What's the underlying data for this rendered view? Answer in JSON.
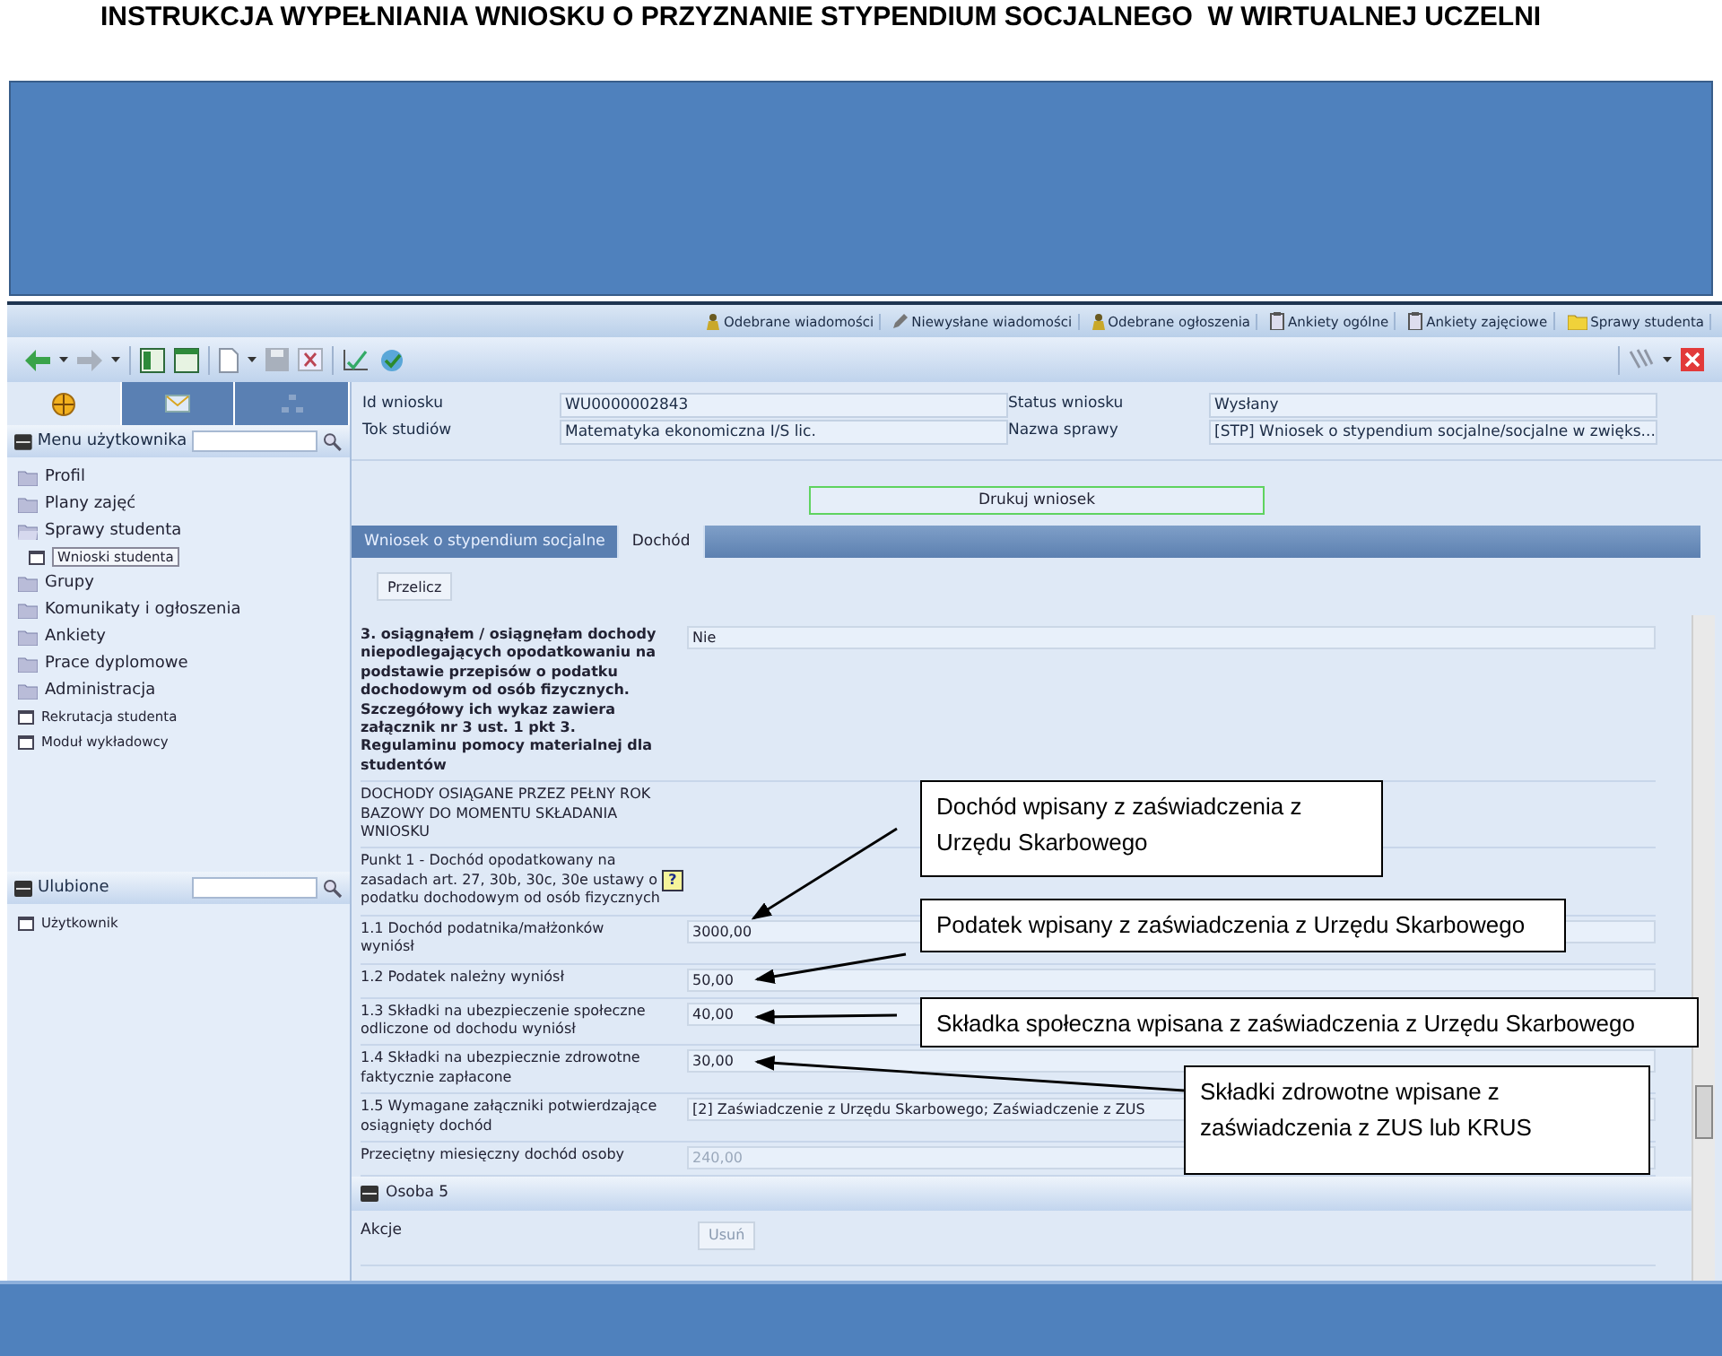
{
  "document_title": "INSTRUKCJA WYPEŁNIANIA WNIOSKU O PRZYZNANIE STYPENDIUM SOCJALNEGO  W WIRTUALNEJ UCZELNI",
  "top_links": [
    "Odebrane wiadomości",
    "Niewysłane wiadomości",
    "Odebrane ogłoszenia",
    "Ankiety ogólne",
    "Ankiety zajęciowe",
    "Sprawy studenta"
  ],
  "sidebar": {
    "tabs": [
      {
        "selected": true
      },
      {
        "selected": false
      },
      {
        "selected": false
      }
    ],
    "menu_title": "Menu użytkownika",
    "menu_items": [
      {
        "label": "Profil",
        "kind": "folder",
        "selected": false
      },
      {
        "label": "Plany zajęć",
        "kind": "folder",
        "selected": false
      },
      {
        "label": "Sprawy studenta",
        "kind": "folder",
        "selected": false,
        "children": [
          {
            "label": "Wnioski studenta",
            "kind": "page",
            "selected": true
          }
        ]
      },
      {
        "label": "Grupy",
        "kind": "folder",
        "selected": false
      },
      {
        "label": "Komunikaty i ogłoszenia",
        "kind": "folder",
        "selected": false
      },
      {
        "label": "Ankiety",
        "kind": "folder",
        "selected": false
      },
      {
        "label": "Prace dyplomowe",
        "kind": "folder",
        "selected": false
      },
      {
        "label": "Administracja",
        "kind": "folder",
        "selected": false
      },
      {
        "label": "Rekrutacja studenta",
        "kind": "page",
        "selected": false
      },
      {
        "label": "Moduł wykładowcy",
        "kind": "page",
        "selected": false
      }
    ],
    "favorites_title": "Ulubione",
    "favorites": [
      {
        "label": "Użytkownik",
        "kind": "page",
        "selected": false
      }
    ]
  },
  "header_fields": [
    {
      "label": "Id wniosku",
      "value": "WU0000002843"
    },
    {
      "label": "Status wniosku",
      "value": "Wysłany"
    },
    {
      "label": "Tok studiów",
      "value": "Matematyka ekonomiczna I/S lic."
    },
    {
      "label": "Nazwa sprawy",
      "value": "[STP] Wniosek o stypendium socjalne/socjalne w zwięks..."
    }
  ],
  "print_button": "Drukuj wniosek",
  "tabs": [
    {
      "label": "Wniosek o stypendium socjalne",
      "selected": false
    },
    {
      "label": "Dochód",
      "selected": true
    }
  ],
  "recalculate_button": "Przelicz",
  "form_rows": [
    {
      "kind": "question",
      "label": "3. osiągnąłem / osiągnęłam dochody niepodlegających opodatkowaniu na podstawie przepisów o podatku dochodowym od osób fizycznych. Szczegółowy ich wykaz zawiera załącznik nr 3 ust. 1 pkt 3. Regulaminu pomocy materialnej dla studentów",
      "value": "Nie",
      "disabled": false
    },
    {
      "kind": "heading",
      "label": "DOCHODY OSIĄGANE PRZEZ PEŁNY ROK BAZOWY DO MOMENTU SKŁADANIA WNIOSKU"
    },
    {
      "kind": "help",
      "label": "Punkt 1 - Dochód opodatkowany na zasadach art. 27, 30b, 30c, 30e ustawy o podatku dochodowym od osób fizycznych",
      "help": "?"
    },
    {
      "kind": "field",
      "label": "1.1 Dochód podatnika/małżonków wyniósł",
      "value": "3000,00",
      "disabled": false
    },
    {
      "kind": "field",
      "label": "1.2 Podatek należny wyniósł",
      "value": "50,00",
      "disabled": false
    },
    {
      "kind": "field",
      "label": "1.3 Składki na ubezpieczenie społeczne odliczone od dochodu wyniósł",
      "value": "40,00",
      "disabled": false
    },
    {
      "kind": "field",
      "label": "1.4 Składki na ubezpiecznie zdrowotne faktycznie zapłacone",
      "value": "30,00",
      "disabled": false
    },
    {
      "kind": "field",
      "label": "1.5 Wymagane załączniki potwierdzające osiągnięty dochód",
      "value": "[2] Zaświadczenie z Urzędu Skarbowego; Zaświadczenie z ZUS",
      "disabled": false
    },
    {
      "kind": "field",
      "label": "Przeciętny miesięczny dochód osoby",
      "value": "240,00",
      "disabled": true
    }
  ],
  "section_title": "Osoba 5",
  "actions_label": "Akcje",
  "delete_button": {
    "label": "Usuń",
    "disabled": true
  },
  "callouts": [
    {
      "text": "Dochód wpisany z zaświadczenia z Urzędu Skarbowego"
    },
    {
      "text": "Podatek wpisany z zaświadczenia z Urzędu Skarbowego"
    },
    {
      "text": "Składka społeczna wpisana z zaświadczenia z Urzędu Skarbowego"
    },
    {
      "text": "Składki zdrowotne wpisane z zaświadczenia z ZUS lub KRUS"
    }
  ]
}
